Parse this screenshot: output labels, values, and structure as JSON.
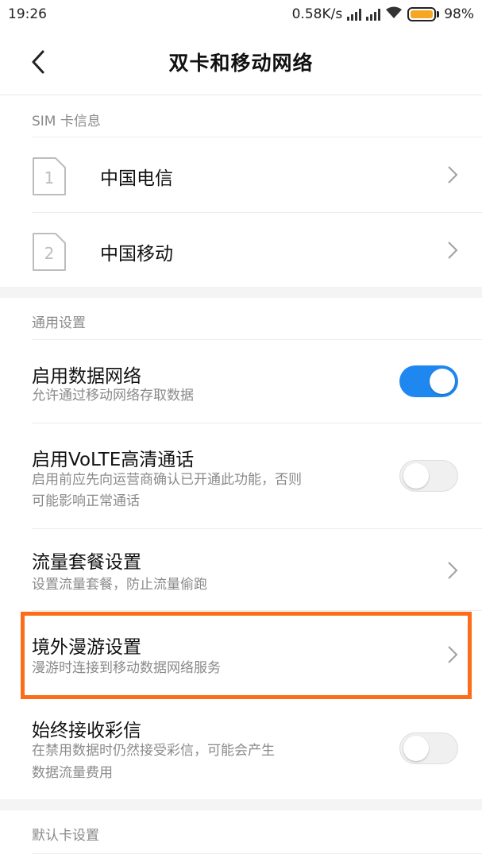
{
  "status_bar": {
    "time": "19:26",
    "net_speed": "0.58K/s",
    "battery_percent": "98%",
    "battery_level": 0.98,
    "icons": [
      "signal-icon",
      "signal-icon",
      "wifi-icon",
      "battery-icon"
    ]
  },
  "header": {
    "title": "双卡和移动网络",
    "back_icon": "chevron-left-icon"
  },
  "sim_section": {
    "label": "SIM 卡信息",
    "cards": [
      {
        "slot": "1",
        "name": "中国电信"
      },
      {
        "slot": "2",
        "name": "中国移动"
      }
    ]
  },
  "general_section": {
    "label": "通用设置",
    "items": [
      {
        "title": "启用数据网络",
        "subtitle": "允许通过移动网络存取数据",
        "control": "toggle",
        "on": true
      },
      {
        "title": "启用VoLTE高清通话",
        "subtitle_line1": "启用前应先向运营商确认已开通此功能，否则",
        "subtitle_line2": "可能影响正常通话",
        "control": "toggle",
        "on": false
      },
      {
        "title": "流量套餐设置",
        "subtitle": "设置流量套餐，防止流量偷跑",
        "control": "chevron"
      },
      {
        "title": "境外漫游设置",
        "subtitle": "漫游时连接到移动数据网络服务",
        "control": "chevron",
        "highlighted": true
      },
      {
        "title": "始终接收彩信",
        "subtitle_line1": "在禁用数据时仍然接受彩信，可能会产生",
        "subtitle_line2": "数据流量费用",
        "control": "toggle",
        "on": false
      }
    ]
  },
  "default_section": {
    "label": "默认卡设置"
  },
  "colors": {
    "accent": "#1e88f0",
    "highlight": "#fc6c1a",
    "secondary_text": "#8a8a8a"
  }
}
